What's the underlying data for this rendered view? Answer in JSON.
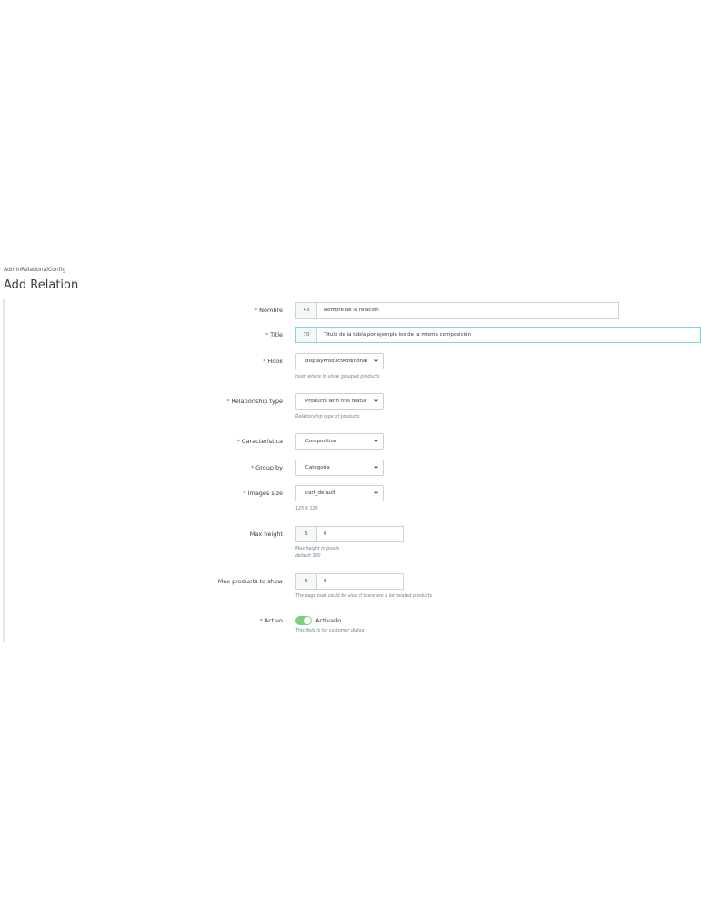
{
  "header": {
    "breadcrumb": "AdminRelationalConfig",
    "title": "Add Relation"
  },
  "form": {
    "nombre": {
      "label": "Nombre",
      "required": true,
      "counter": "43",
      "value": "Nombre de la relación"
    },
    "title": {
      "label": "Title",
      "required": true,
      "counter": "70",
      "value": "Titulo de la tabla por ejemplo los de la misma composición"
    },
    "hook": {
      "label": "Hook",
      "required": true,
      "selected": "displayProductAdditional",
      "help": "hook where to show grouped products"
    },
    "relationship_type": {
      "label": "Relationship type",
      "required": true,
      "selected": "Products with this featur",
      "help": "Relationship type of products"
    },
    "caracteristica": {
      "label": "Característica",
      "required": true,
      "selected": "Composition"
    },
    "group_by": {
      "label": "Group by",
      "required": true,
      "selected": "Categoría"
    },
    "images_size": {
      "label": "Images size",
      "required": true,
      "selected": "cart_default",
      "help": "125 X 125"
    },
    "max_height": {
      "label": "Max height",
      "required": false,
      "counter": "5",
      "value": "0",
      "help_line1": "Max height in pixels",
      "help_line2": "default 300"
    },
    "max_products": {
      "label": "Max products to show",
      "required": false,
      "counter": "5",
      "value": "0",
      "help": "The page load could be slow if there are a lot related products"
    },
    "activo": {
      "label": "Activo",
      "required": true,
      "state": "Activado",
      "on": true,
      "help": "This field is for customer dialog"
    }
  },
  "colors": {
    "accent": "#78d07d",
    "required": "#c05c67",
    "focus": "#7cd5e2"
  }
}
